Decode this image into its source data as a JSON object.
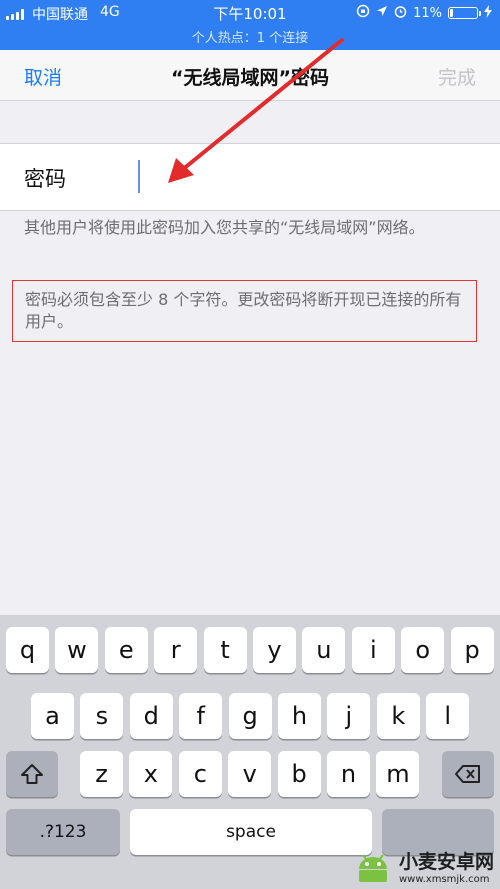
{
  "status_bar": {
    "carrier": "中国联通",
    "network": "4G",
    "time": "下午10:01",
    "battery_percent": "11%",
    "battery_level": 0.11,
    "hotspot_text": "个人热点：1 个连接"
  },
  "nav": {
    "cancel": "取消",
    "title": "“无线局域网”密码",
    "done": "完成"
  },
  "password": {
    "label": "密码",
    "value": ""
  },
  "notes": {
    "share_info": "其他用户将使用此密码加入您共享的“无线局域网”网络。",
    "requirement": "密码必须包含至少 8 个字符。更改密码将断开现已连接的所有用户。"
  },
  "keyboard": {
    "row1": [
      "q",
      "w",
      "e",
      "r",
      "t",
      "y",
      "u",
      "i",
      "o",
      "p"
    ],
    "row2": [
      "a",
      "s",
      "d",
      "f",
      "g",
      "h",
      "j",
      "k",
      "l"
    ],
    "row3": [
      "z",
      "x",
      "c",
      "v",
      "b",
      "n",
      "m"
    ],
    "numbers_key": ".?123",
    "space_key": "space"
  },
  "watermark": {
    "name": "小麦安卓网",
    "url": "www.xmsmjk.com"
  },
  "colors": {
    "status_bar": "#2f7ff3",
    "accent": "#1b7cf6",
    "highlight_border": "#e23636"
  }
}
